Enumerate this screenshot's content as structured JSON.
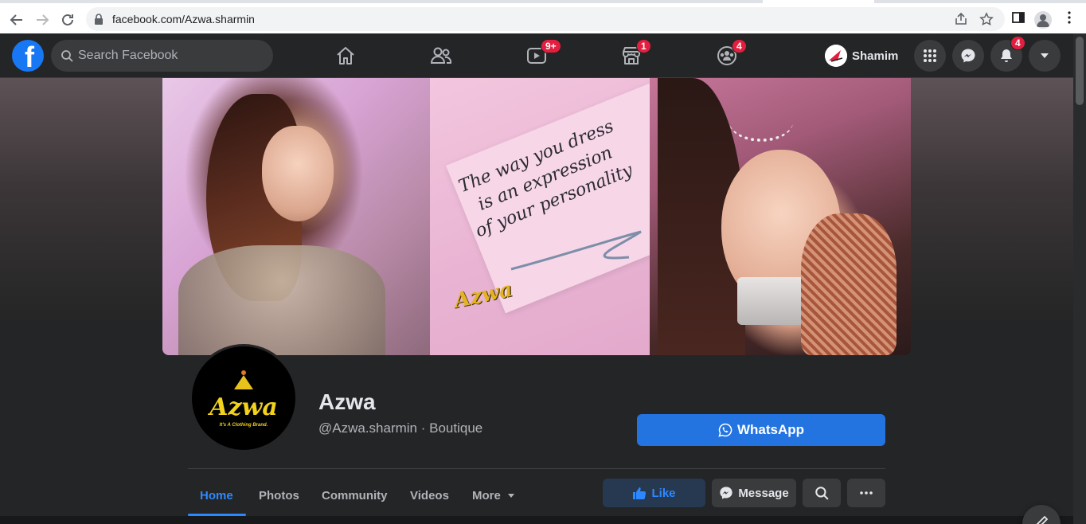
{
  "browser": {
    "url": "facebook.com/Azwa.sharmin"
  },
  "fb": {
    "search_placeholder": "Search Facebook",
    "badges": {
      "watch": "9+",
      "marketplace": "1",
      "groups": "4",
      "notifications": "4"
    },
    "profile_name": "Shamim"
  },
  "cover": {
    "quote_lines": [
      "The way you dress",
      "is an expression",
      "of your personality"
    ],
    "brandmark": "Azwa"
  },
  "avatar": {
    "logo": "Azwa",
    "tagline": "It's A Clothing Brand."
  },
  "page": {
    "name": "Azwa",
    "handle": "@Azwa.sharmin · Boutique",
    "cta": "WhatsApp"
  },
  "tabs": [
    "Home",
    "Photos",
    "Community",
    "Videos",
    "More"
  ],
  "actions": {
    "like": "Like",
    "message": "Message"
  },
  "colors": {
    "accent": "#2374e1",
    "badge": "#e41e3f",
    "bar": "#242526"
  }
}
